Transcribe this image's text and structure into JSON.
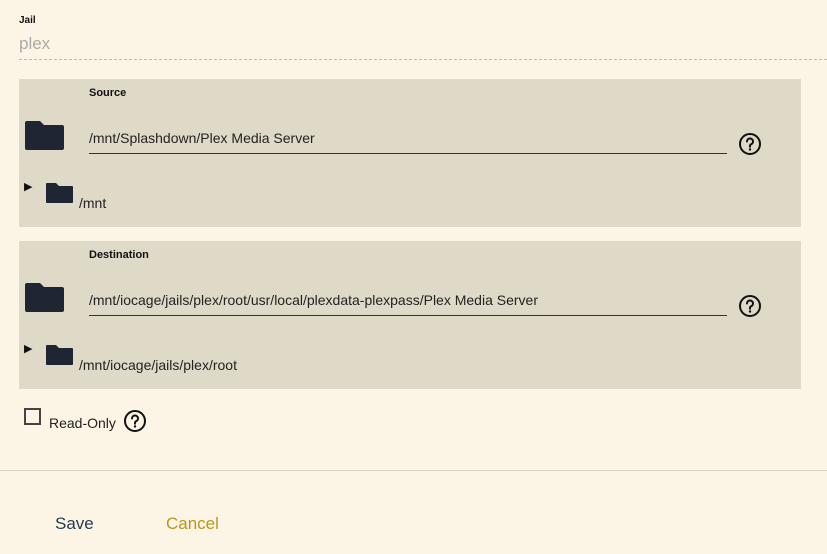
{
  "jail": {
    "label": "Jail",
    "value": "plex"
  },
  "source": {
    "label": "Source",
    "path": "/mnt/Splashdown/Plex Media Server",
    "tree_root": "/mnt"
  },
  "destination": {
    "label": "Destination",
    "path": "/mnt/iocage/jails/plex/root/usr/local/plexdata-plexpass/Plex Media Server",
    "tree_root": "/mnt/iocage/jails/plex/root"
  },
  "read_only": {
    "label": "Read-Only",
    "checked": false
  },
  "actions": {
    "save_label": "Save",
    "cancel_label": "Cancel"
  },
  "icons": {
    "folder": "folder-icon",
    "help": "help-circle-icon",
    "expand": "expand-arrow-icon"
  },
  "colors": {
    "background": "#fcf5e5",
    "panel": "#dfd9c7",
    "save": "#1f3b4d",
    "cancel": "#b9961e",
    "folder": "#1f2533"
  }
}
